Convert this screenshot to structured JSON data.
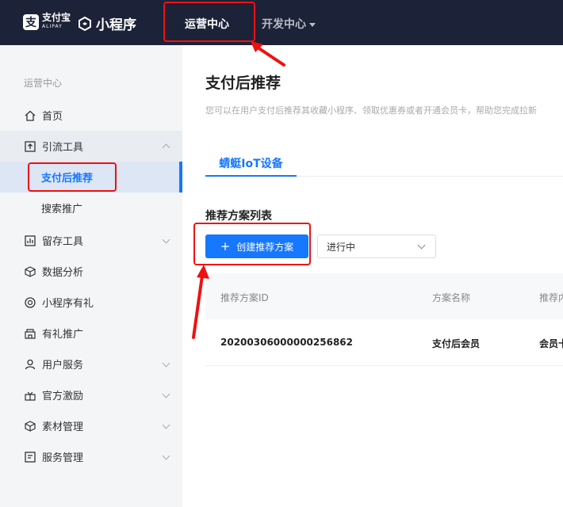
{
  "header": {
    "alipay_logo_mark": "支",
    "alipay_logo_cn": "支付宝",
    "alipay_logo_en": "ALIPAY",
    "miniapp_logo": "小程序",
    "nav_ops": "运营中心",
    "nav_dev": "开发中心"
  },
  "sidebar": {
    "title": "运营中心",
    "items": [
      {
        "label": "首页",
        "icon": "home-icon"
      },
      {
        "label": "引流工具",
        "icon": "traffic-icon"
      },
      {
        "label": "支付后推荐"
      },
      {
        "label": "搜索推广"
      },
      {
        "label": "留存工具",
        "icon": "chart-icon"
      },
      {
        "label": "数据分析",
        "icon": "cube-icon"
      },
      {
        "label": "小程序有礼",
        "icon": "gift-icon"
      },
      {
        "label": "有礼推广",
        "icon": "shop-icon"
      },
      {
        "label": "用户服务",
        "icon": "user-icon"
      },
      {
        "label": "官方激励",
        "icon": "reward-icon"
      },
      {
        "label": "素材管理",
        "icon": "box-icon"
      },
      {
        "label": "服务管理",
        "icon": "service-icon"
      }
    ]
  },
  "main": {
    "title": "支付后推荐",
    "description": "您可以在用户支付后推荐其收藏小程序、领取优惠券或者开通会员卡，帮助您完成拉新",
    "tab": "蜻蜓IoT设备",
    "section_title": "推荐方案列表",
    "create_button": "创建推荐方案",
    "status_select": "进行中",
    "table": {
      "headers": [
        "推荐方案ID",
        "方案名称",
        "推荐内"
      ],
      "rows": [
        [
          "20200306000000256862",
          "支付后会员",
          "会员卡"
        ]
      ]
    }
  },
  "colors": {
    "topbar": "#1c2237",
    "accent": "#1677ff",
    "annotation": "#ee1111"
  }
}
